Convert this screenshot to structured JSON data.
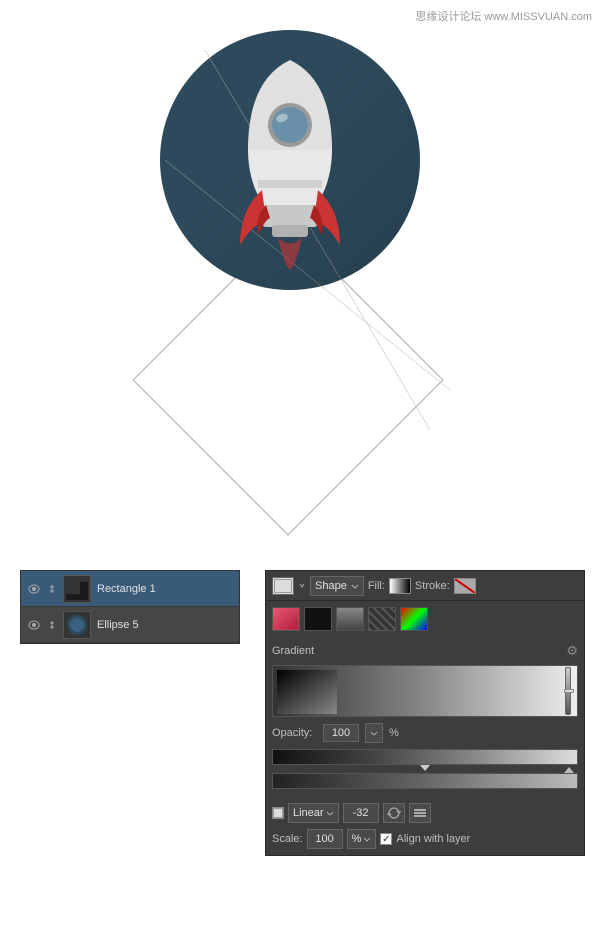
{
  "watermark": {
    "text": "思缘设计论坛 www.MISSVUAN.com"
  },
  "canvas": {
    "bg": "#ffffff"
  },
  "rocket": {
    "circle_bg": "#2d4a5c"
  },
  "layers": {
    "items": [
      {
        "name": "Rectangle 1",
        "selected": true
      },
      {
        "name": "Ellipse 5",
        "selected": false
      }
    ]
  },
  "properties": {
    "shape_label": "Shape",
    "fill_label": "Fill:",
    "stroke_label": "Stroke:",
    "gradient_label": "Gradient",
    "opacity_label": "Opacity:",
    "opacity_value": "100",
    "opacity_unit": "%",
    "linear_label": "Linear",
    "angle_value": "-32",
    "scale_label": "Scale:",
    "scale_value": "100",
    "scale_unit": "%",
    "align_label": "Align with layer"
  }
}
